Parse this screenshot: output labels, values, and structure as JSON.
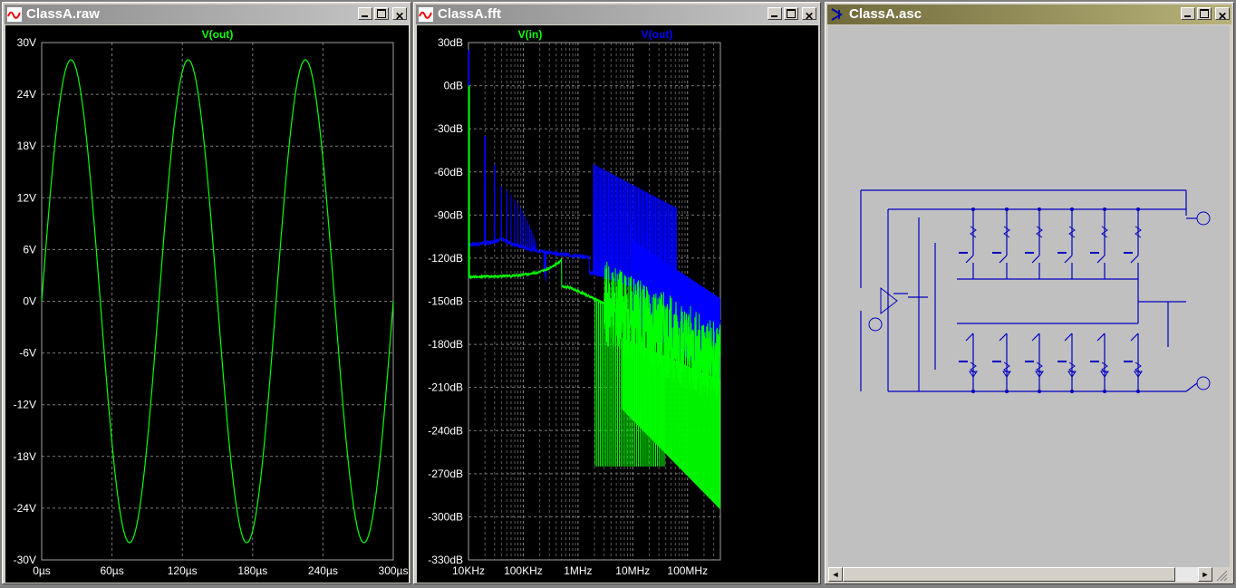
{
  "windows": {
    "raw": {
      "title": "ClassA.raw",
      "trace_label": "V(out)",
      "trace_color": "#00ff00",
      "y_ticks": [
        "30V",
        "24V",
        "18V",
        "12V",
        "6V",
        "0V",
        "-6V",
        "-12V",
        "-18V",
        "-24V",
        "-30V"
      ],
      "x_ticks": [
        "0µs",
        "60µs",
        "120µs",
        "180µs",
        "240µs",
        "300µs"
      ]
    },
    "fft": {
      "title": "ClassA.fft",
      "trace_labels": [
        "V(in)",
        "V(out)"
      ],
      "trace_colors": [
        "#00ff00",
        "#0000ff"
      ],
      "y_ticks": [
        "30dB",
        "0dB",
        "-30dB",
        "-60dB",
        "-90dB",
        "-120dB",
        "-150dB",
        "-180dB",
        "-210dB",
        "-240dB",
        "-270dB",
        "-300dB",
        "-330dB"
      ],
      "x_ticks": [
        "10KHz",
        "100KHz",
        "1MHz",
        "10MHz",
        "100MHz"
      ]
    },
    "asc": {
      "title": "ClassA.asc",
      "scrollbar_left": "◄",
      "scrollbar_right": "►"
    }
  },
  "chart_data": [
    {
      "type": "line",
      "title": "",
      "xlabel": "",
      "ylabel": "",
      "xlim": [
        0,
        300
      ],
      "ylim": [
        -30,
        30
      ],
      "x_unit": "µs",
      "y_unit": "V",
      "grid": true,
      "series": [
        {
          "name": "V(out)",
          "color": "#00ff00",
          "function": "sine",
          "amplitude": 28,
          "frequency_khz": 10,
          "offset": 0
        }
      ]
    },
    {
      "type": "line",
      "title": "",
      "xlabel": "",
      "ylabel": "",
      "x_scale": "log",
      "x_unit": "Hz",
      "y_unit": "dB",
      "ylim": [
        -330,
        30
      ],
      "grid": true,
      "series": [
        {
          "name": "V(in)",
          "color": "#00ff00",
          "fundamental_khz": 10,
          "peak_db": 0,
          "floor_db": -133,
          "high_freq_floor_db": -220
        },
        {
          "name": "V(out)",
          "color": "#0000ff",
          "fundamental_khz": 10,
          "peak_db": 25,
          "floor_db": -113,
          "harmonic_peaks_db": [
            -35,
            -55,
            -70
          ]
        }
      ]
    }
  ]
}
